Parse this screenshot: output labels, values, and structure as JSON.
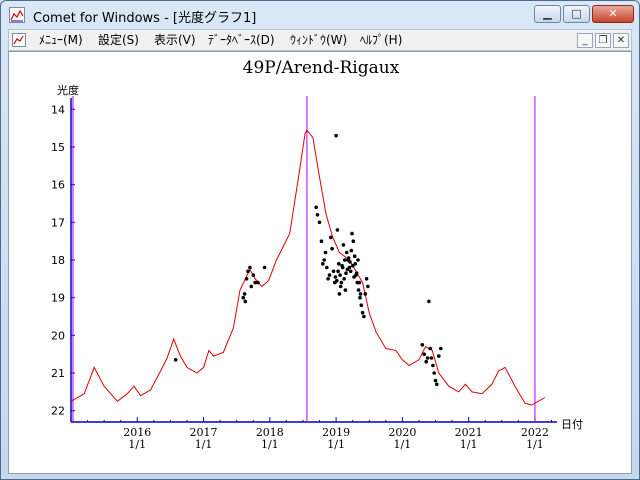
{
  "window": {
    "title": "Comet for Windows - [光度グラフ1]"
  },
  "window_controls": {
    "minimize": "▁",
    "maximize": "□",
    "close": "✕"
  },
  "menu": [
    {
      "label": "ﾒﾆｭｰ(M)"
    },
    {
      "label": "設定(S)"
    },
    {
      "label": "表示(V)"
    },
    {
      "label": "ﾃﾞｰﾀﾍﾞｰｽ(D)"
    },
    {
      "label": "ｳｨﾝﾄﾞｳ(W)"
    },
    {
      "label": "ﾍﾙﾌﾟ(H)"
    }
  ],
  "mdi_controls": {
    "minimize": "_",
    "restore": "❐",
    "close": "✕"
  },
  "chart_data": {
    "type": "scatter",
    "title": "49P/Arend-Rigaux",
    "ylabel": "光度",
    "xlabel": "日付",
    "y_inverted": true,
    "ylim": [
      13.7,
      22.3
    ],
    "yticks": [
      "14",
      "15",
      "16",
      "17",
      "18",
      "19",
      "20",
      "21",
      "22"
    ],
    "xlim": [
      "2015-01-01",
      "2022-05-01"
    ],
    "xticks": [
      {
        "year": "2016",
        "md": "1/1"
      },
      {
        "year": "2017",
        "md": "1/1"
      },
      {
        "year": "2018",
        "md": "1/1"
      },
      {
        "year": "2019",
        "md": "1/1"
      },
      {
        "year": "2020",
        "md": "1/1"
      },
      {
        "year": "2021",
        "md": "1/1"
      },
      {
        "year": "2022",
        "md": "1/1"
      }
    ],
    "marker_lines": [
      2015.03,
      2018.56,
      2022.0
    ],
    "colors": {
      "curve": "#dd0000",
      "points": "#000000",
      "marker_lines": "#b400ff",
      "axis": "#0000c8"
    },
    "series": [
      {
        "kind": "curve",
        "x": [
          2015.0,
          2015.2,
          2015.35,
          2015.5,
          2015.7,
          2015.85,
          2015.95,
          2016.05,
          2016.2,
          2016.35,
          2016.45,
          2016.55,
          2016.65,
          2016.75,
          2016.9,
          2017.0,
          2017.08,
          2017.15,
          2017.3,
          2017.45,
          2017.55,
          2017.7,
          2017.78,
          2017.88,
          2017.98,
          2018.1,
          2018.3,
          2018.45,
          2018.53,
          2018.56,
          2018.65,
          2018.75,
          2018.85,
          2018.95,
          2019.05,
          2019.2,
          2019.3,
          2019.4,
          2019.5,
          2019.6,
          2019.75,
          2019.9,
          2020.0,
          2020.1,
          2020.25,
          2020.35,
          2020.45,
          2020.55,
          2020.7,
          2020.85,
          2020.95,
          2021.05,
          2021.2,
          2021.35,
          2021.45,
          2021.55,
          2021.7,
          2021.85,
          2021.95,
          2022.05,
          2022.15
        ],
        "y": [
          21.75,
          21.55,
          20.85,
          21.35,
          21.75,
          21.55,
          21.35,
          21.6,
          21.45,
          20.95,
          20.6,
          20.1,
          20.55,
          20.85,
          21.0,
          20.85,
          20.4,
          20.55,
          20.45,
          19.8,
          18.8,
          18.25,
          18.5,
          18.7,
          18.55,
          18.0,
          17.3,
          15.6,
          14.65,
          14.55,
          14.75,
          15.8,
          16.8,
          17.4,
          17.8,
          18.0,
          18.3,
          18.6,
          19.4,
          19.9,
          20.35,
          20.4,
          20.65,
          20.8,
          20.65,
          20.3,
          20.4,
          21.0,
          21.35,
          21.5,
          21.3,
          21.5,
          21.55,
          21.3,
          20.95,
          20.85,
          21.35,
          21.8,
          21.85,
          21.75,
          21.65
        ]
      },
      {
        "kind": "points",
        "x": [
          2016.58,
          2017.6,
          2017.62,
          2017.63,
          2017.65,
          2017.67,
          2017.7,
          2017.72,
          2017.75,
          2017.78,
          2017.82,
          2017.92,
          2018.7,
          2018.72,
          2018.75,
          2018.78,
          2018.8,
          2018.82,
          2018.84,
          2018.86,
          2018.88,
          2018.9,
          2018.92,
          2018.94,
          2018.96,
          2018.98,
          2019.0,
          2019.02,
          2019.04,
          2019.06,
          2019.08,
          2019.1,
          2019.12,
          2019.14,
          2019.16,
          2019.18,
          2019.2,
          2019.22,
          2019.24,
          2019.26,
          2019.28,
          2019.3,
          2019.32,
          2019.34,
          2019.36,
          2019.38,
          2019.4,
          2019.42,
          2019.44,
          2019.46,
          2019.48,
          2018.99,
          2019.01,
          2019.03,
          2019.05,
          2019.07,
          2019.09,
          2019.11,
          2019.13,
          2019.15,
          2019.17,
          2019.19,
          2019.21,
          2019.23,
          2019.25,
          2019.27,
          2019.29,
          2019.31,
          2019.33,
          2019.35,
          2019.37,
          2020.3,
          2020.33,
          2020.36,
          2020.38,
          2020.4,
          2020.42,
          2020.44,
          2020.46,
          2020.48,
          2020.5,
          2020.52,
          2020.55,
          2020.58
        ],
        "y": [
          20.65,
          19.0,
          18.9,
          19.1,
          18.5,
          18.3,
          18.2,
          18.7,
          18.4,
          18.6,
          18.6,
          18.2,
          16.6,
          16.8,
          17.0,
          17.5,
          18.1,
          18.0,
          17.8,
          18.2,
          18.5,
          18.4,
          17.4,
          17.7,
          18.3,
          18.6,
          14.7,
          17.2,
          18.1,
          18.4,
          18.6,
          18.2,
          18.5,
          18.8,
          17.8,
          18.0,
          18.2,
          18.3,
          17.3,
          17.5,
          17.9,
          18.4,
          18.6,
          18.8,
          19.0,
          19.2,
          19.4,
          19.5,
          18.9,
          18.5,
          18.7,
          18.45,
          18.55,
          18.3,
          18.9,
          18.7,
          18.15,
          17.6,
          18.0,
          18.35,
          18.25,
          17.95,
          18.05,
          17.75,
          18.15,
          18.45,
          18.1,
          18.35,
          18.0,
          18.6,
          18.9,
          20.25,
          20.5,
          20.7,
          20.6,
          19.1,
          20.35,
          20.6,
          20.8,
          21.0,
          21.2,
          21.3,
          20.55,
          20.35
        ]
      }
    ]
  }
}
